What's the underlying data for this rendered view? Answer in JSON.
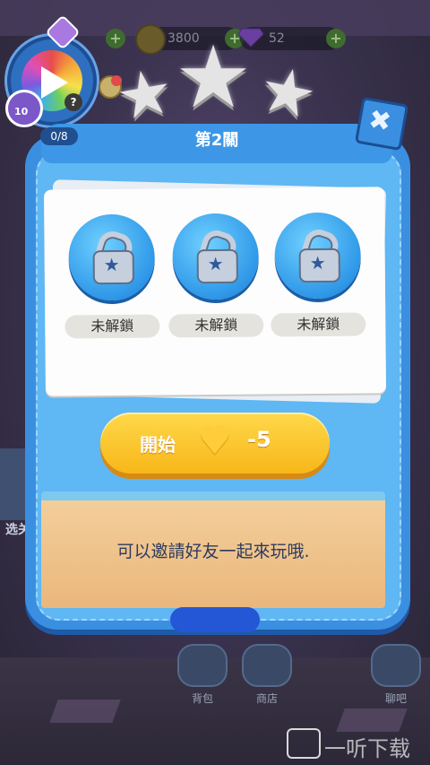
{
  "resources": {
    "coins": "3800",
    "gems": "52",
    "add_symbol": "+"
  },
  "player": {
    "level": "10",
    "help_symbol": "?"
  },
  "stars": {
    "earned": 0,
    "total": 3
  },
  "popup": {
    "title": "第2關",
    "progress": "0/8",
    "close_symbol": "✖"
  },
  "rewards": [
    {
      "label": "未解鎖",
      "icon": "lock-icon"
    },
    {
      "label": "未解鎖",
      "icon": "lock-icon"
    },
    {
      "label": "未解鎖",
      "icon": "lock-icon"
    }
  ],
  "start": {
    "label": "開始",
    "cost": "-5",
    "icon": "heart-icon"
  },
  "hint": "可以邀請好友一起來玩哦.",
  "background_nav": {
    "left": "选关",
    "bag": "背包",
    "shop": "商店",
    "chat": "聊吧"
  },
  "watermark": "一听下载",
  "colors": {
    "popup_blue": "#3b8fe0",
    "start_yellow": "#ffd84a",
    "sand": "#f3ce9a"
  }
}
